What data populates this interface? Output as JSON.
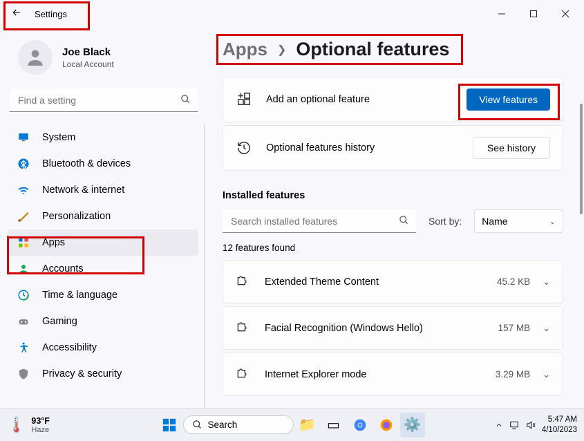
{
  "window": {
    "title": "Settings"
  },
  "user": {
    "name": "Joe Black",
    "type": "Local Account"
  },
  "sidebar_search": {
    "placeholder": "Find a setting"
  },
  "nav": [
    {
      "label": "System",
      "icon": "display"
    },
    {
      "label": "Bluetooth & devices",
      "icon": "bluetooth"
    },
    {
      "label": "Network & internet",
      "icon": "wifi"
    },
    {
      "label": "Personalization",
      "icon": "brush"
    },
    {
      "label": "Apps",
      "icon": "apps",
      "selected": true
    },
    {
      "label": "Accounts",
      "icon": "person"
    },
    {
      "label": "Time & language",
      "icon": "clock"
    },
    {
      "label": "Gaming",
      "icon": "gaming"
    },
    {
      "label": "Accessibility",
      "icon": "accessibility"
    },
    {
      "label": "Privacy & security",
      "icon": "shield"
    }
  ],
  "breadcrumb": {
    "parent": "Apps",
    "current": "Optional features"
  },
  "cards": {
    "add": {
      "label": "Add an optional feature",
      "button": "View features"
    },
    "history": {
      "label": "Optional features history",
      "button": "See history"
    }
  },
  "installed": {
    "header": "Installed features",
    "search_placeholder": "Search installed features",
    "sort_label": "Sort by:",
    "sort_value": "Name",
    "count_text": "12 features found"
  },
  "features": [
    {
      "name": "Extended Theme Content",
      "size": "45.2 KB"
    },
    {
      "name": "Facial Recognition (Windows Hello)",
      "size": "157 MB"
    },
    {
      "name": "Internet Explorer mode",
      "size": "3.29 MB"
    }
  ],
  "taskbar": {
    "weather": {
      "temp": "93°F",
      "cond": "Haze"
    },
    "search": "Search",
    "time": "5:47 AM",
    "date": "4/10/2023"
  }
}
